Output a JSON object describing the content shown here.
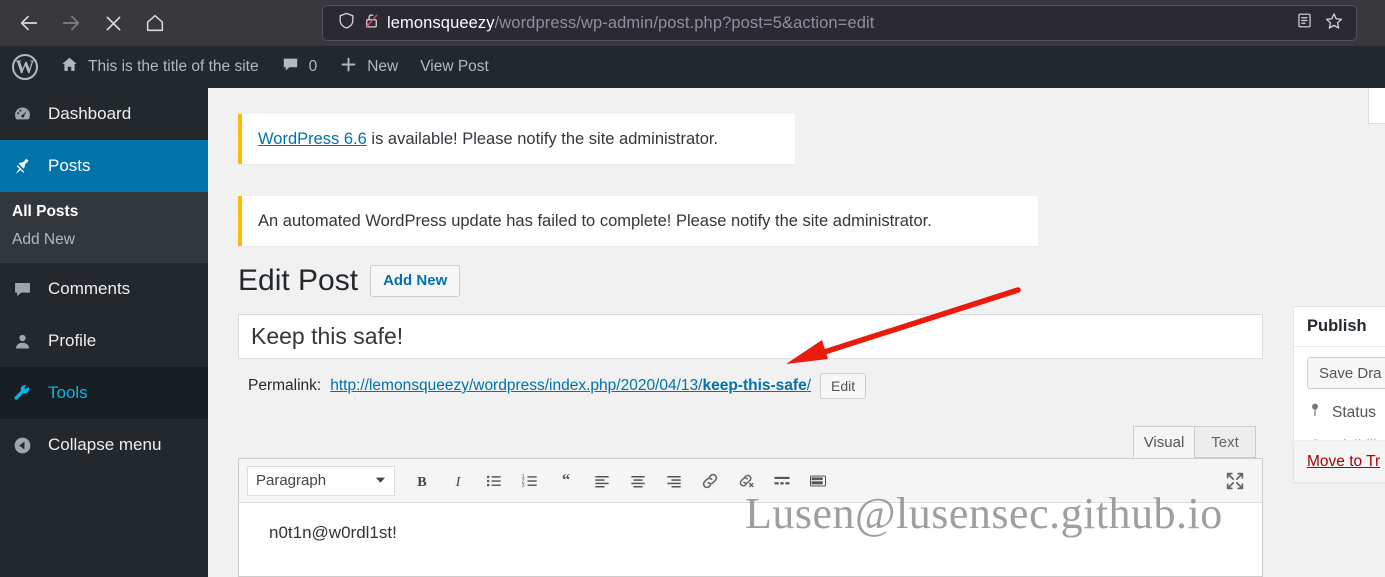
{
  "browser": {
    "back_icon": "arrow-left-icon",
    "forward_icon": "arrow-right-icon",
    "stop_icon": "close-icon",
    "home_icon": "home-icon",
    "shield_icon": "shield-icon",
    "lock_broken_icon": "lock-broken-icon",
    "reader_icon": "reader-view-icon",
    "bookmark_icon": "star-icon",
    "url_host": "lemonsqueezy",
    "url_path": "/wordpress/wp-admin/post.php?post=5&action=edit",
    "url_full": "lemonsqueezy/wordpress/wp-admin/post.php?post=5&action=edit"
  },
  "adminbar": {
    "logo_icon": "wordpress-logo-icon",
    "logo_glyph": "W",
    "home_icon": "home-icon",
    "site_title": "This is the title of the site",
    "comments_icon": "comment-bubble-icon",
    "comments_count": "0",
    "new_icon": "plus-icon",
    "new_label": "New",
    "view_post_label": "View Post"
  },
  "sidebar": {
    "items": [
      {
        "label": "Dashboard",
        "icon": "dashboard-gauge-icon",
        "state": "normal"
      },
      {
        "label": "Posts",
        "icon": "pin-icon",
        "state": "current"
      },
      {
        "label": "Comments",
        "icon": "comment-bubble-icon",
        "state": "normal"
      },
      {
        "label": "Profile",
        "icon": "user-icon",
        "state": "normal"
      },
      {
        "label": "Tools",
        "icon": "wrench-icon",
        "state": "hovered"
      },
      {
        "label": "Collapse menu",
        "icon": "collapse-arrow-icon",
        "state": "normal"
      }
    ],
    "submenu": [
      {
        "label": "All Posts",
        "state": "current"
      },
      {
        "label": "Add New",
        "state": "normal"
      }
    ]
  },
  "notices": [
    {
      "link_text": "WordPress 6.6",
      "rest_text": " is available! Please notify the site administrator.",
      "accent": "#ffb900"
    },
    {
      "link_text": "",
      "rest_text": "An automated WordPress update has failed to complete! Please notify the site administrator.",
      "accent": "#ffb900"
    }
  ],
  "page": {
    "title": "Edit Post",
    "add_new_label": "Add New"
  },
  "post": {
    "title_value": "Keep this safe!",
    "permalink_label": "Permalink:",
    "permalink_prefix": "http://lemonsqueezy/wordpress/index.php/2020/04/13/",
    "permalink_slug": "keep-this-safe",
    "permalink_suffix": "/",
    "edit_slug_label": "Edit",
    "content": "n0t1n@w0rdl1st!"
  },
  "editor": {
    "tabs": [
      {
        "label": "Visual",
        "active": true
      },
      {
        "label": "Text",
        "active": false
      }
    ],
    "format_select_value": "Paragraph",
    "toolbar_buttons": [
      {
        "name": "bold-icon",
        "glyph": "B"
      },
      {
        "name": "italic-icon",
        "glyph": "I"
      },
      {
        "name": "bulleted-list-icon",
        "glyph": ""
      },
      {
        "name": "numbered-list-icon",
        "glyph": ""
      },
      {
        "name": "blockquote-icon",
        "glyph": "“"
      },
      {
        "name": "align-left-icon",
        "glyph": ""
      },
      {
        "name": "align-center-icon",
        "glyph": ""
      },
      {
        "name": "align-right-icon",
        "glyph": ""
      },
      {
        "name": "link-icon",
        "glyph": ""
      },
      {
        "name": "unlink-icon",
        "glyph": ""
      },
      {
        "name": "insert-read-more-icon",
        "glyph": ""
      },
      {
        "name": "toolbar-toggle-icon",
        "glyph": ""
      }
    ],
    "fullscreen_icon": "fullscreen-icon"
  },
  "publish": {
    "header": "Publish",
    "save_draft_label": "Save Dra",
    "status_icon": "pin-marker-icon",
    "status_label": "Status",
    "visibility_icon": "eye-icon",
    "visibility_label": "Visibili",
    "trash_label": "Move to Tr"
  },
  "annotation": {
    "arrow_color": "#e81b0d",
    "arrow_name": "red-pointer-arrow"
  },
  "watermark": {
    "text": "Lusen@lusensec.github.io"
  },
  "colors": {
    "wp_blue": "#0073aa",
    "admin_dark": "#23282d",
    "notice_amber": "#ffb900",
    "trash_red": "#a00"
  }
}
